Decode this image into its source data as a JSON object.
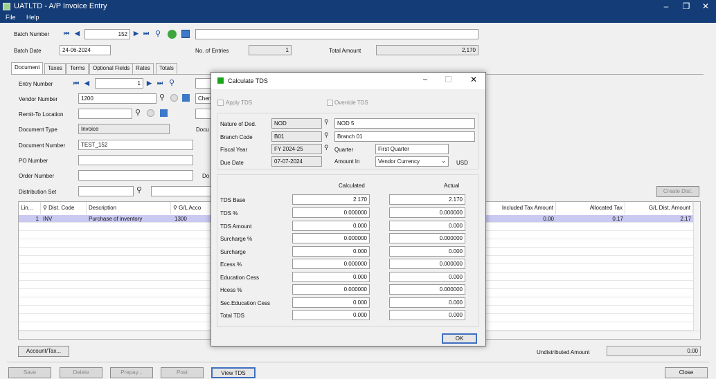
{
  "window": {
    "title": "UATLTD - A/P Invoice Entry",
    "minimize": "–",
    "restore": "❐",
    "close": "✕"
  },
  "menu": {
    "file": "File",
    "help": "Help"
  },
  "batch": {
    "number_label": "Batch Number",
    "number": "152",
    "date_label": "Batch Date",
    "date": "24-06-2024",
    "entries_label": "No. of Entries",
    "entries": "1",
    "total_label": "Total Amount",
    "total": "2,170",
    "description": ""
  },
  "tabs": [
    "Document",
    "Taxes",
    "Terms",
    "Optional Fields",
    "Rates",
    "Totals"
  ],
  "document": {
    "entry_label": "Entry Number",
    "entry": "1",
    "vendor_label": "Vendor Number",
    "vendor": "1200",
    "vendor_name": "Chen",
    "remit_label": "Remit-To Location",
    "doctype_label": "Document Type",
    "doctype": "Invoice",
    "docdate_label": "Docu",
    "docnum_label": "Document Number",
    "docnum": "TEST_152",
    "po_label": "PO Number",
    "order_label": "Order Number",
    "order_right_label": "Do",
    "dist_label": "Distribution Set",
    "create_dist": "Create Dist."
  },
  "grid": {
    "headers": {
      "line": "Lin...",
      "dist": "Dist. Code",
      "desc": "Description",
      "gl": "G/L Acco",
      "inctax": "Included Tax Amount",
      "alloc": "Allocated Tax",
      "gldist": "G/L Dist. Amount"
    },
    "rows": [
      {
        "line": "1",
        "dist": "INV",
        "desc": "Purchase of inventory",
        "gl": "1300",
        "inctax": "0.00",
        "alloc": "0.17",
        "gldist": "2.17"
      }
    ]
  },
  "bottom": {
    "account_tax": "Account/Tax...",
    "undistributed_label": "Undistributed Amount",
    "undistributed": "0.00"
  },
  "buttons": {
    "save": "Save",
    "delete": "Delete",
    "prepay": "Prepay...",
    "post": "Post",
    "viewtds": "View TDS",
    "close": "Close"
  },
  "dialog": {
    "title": "Calculate TDS",
    "apply_tds": "Apply TDS",
    "override_tds": "Override TDS",
    "nature_label": "Nature of Ded.",
    "nature": "NOD",
    "nature_desc": "NOD 5",
    "branch_label": "Branch Code",
    "branch": "B01",
    "branch_desc": "Branch 01",
    "fy_label": "Fiscal Year",
    "fy": "FY 2024-25",
    "quarter_label": "Quarter",
    "quarter": "First Quarter",
    "due_label": "Due Date",
    "due": "07-07-2024",
    "amountin_label": "Amount In",
    "amountin": "Vendor Currency",
    "currency": "USD",
    "calc_header": "Calculated",
    "actual_header": "Actual",
    "rows": [
      {
        "label": "TDS Base",
        "calc": "2.170",
        "actual": "2.170"
      },
      {
        "label": "TDS %",
        "calc": "0.000000",
        "actual": "0.000000"
      },
      {
        "label": "TDS Amount",
        "calc": "0.000",
        "actual": "0.000"
      },
      {
        "label": "Surcharge %",
        "calc": "0.000000",
        "actual": "0.000000"
      },
      {
        "label": "Surcharge",
        "calc": "0.000",
        "actual": "0.000"
      },
      {
        "label": "Ecess %",
        "calc": "0.000000",
        "actual": "0.000000"
      },
      {
        "label": "Education Cess",
        "calc": "0.000",
        "actual": "0.000"
      },
      {
        "label": "Hcess %",
        "calc": "0.000000",
        "actual": "0.000000"
      },
      {
        "label": "Sec.Education Cess",
        "calc": "0.000",
        "actual": "0.000"
      },
      {
        "label": "Total TDS",
        "calc": "0.000",
        "actual": "0.000"
      }
    ],
    "ok": "OK"
  }
}
